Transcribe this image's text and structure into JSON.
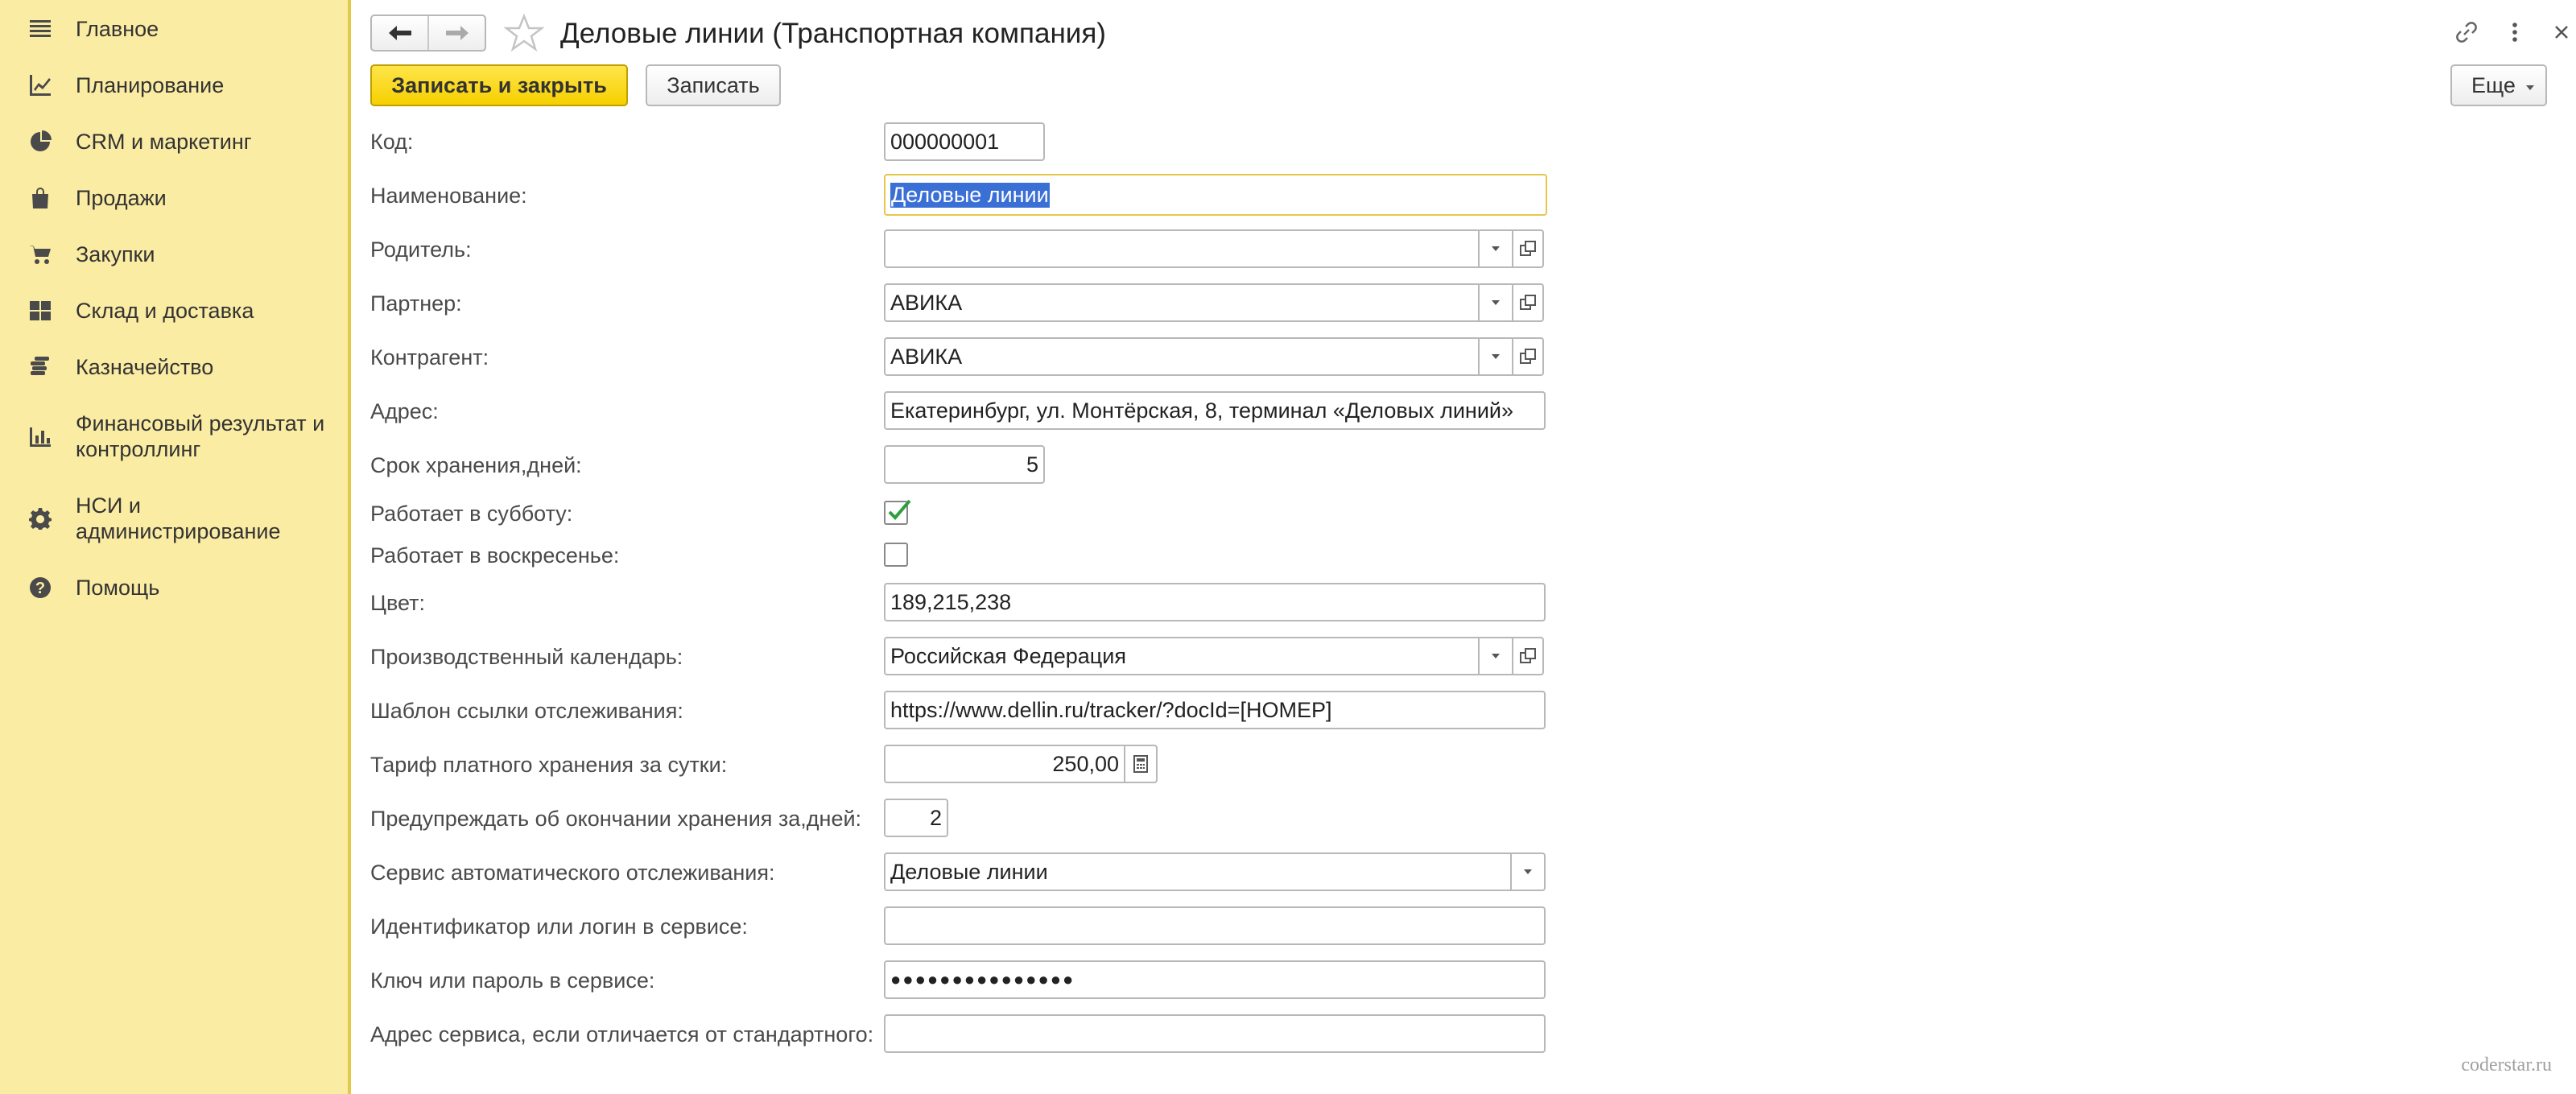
{
  "sidebar": {
    "items": [
      {
        "label": "Главное",
        "icon": "menu-lines-icon"
      },
      {
        "label": "Планирование",
        "icon": "planning-chart-icon"
      },
      {
        "label": "CRM и маркетинг",
        "icon": "pie-chart-icon"
      },
      {
        "label": "Продажи",
        "icon": "shopping-bag-icon"
      },
      {
        "label": "Закупки",
        "icon": "cart-icon"
      },
      {
        "label": "Склад и доставка",
        "icon": "grid-icon"
      },
      {
        "label": "Казначейство",
        "icon": "coins-icon"
      },
      {
        "label": "Финансовый результат и контроллинг",
        "icon": "bar-chart-icon"
      },
      {
        "label": "НСИ и администрирование",
        "icon": "gear-icon"
      },
      {
        "label": "Помощь",
        "icon": "help-icon"
      }
    ]
  },
  "header": {
    "title": "Деловые линии (Транспортная компания)"
  },
  "toolbar": {
    "save_close_label": "Записать и закрыть",
    "save_label": "Записать",
    "more_label": "Еще"
  },
  "form": {
    "code": {
      "label": "Код:",
      "value": "000000001"
    },
    "name": {
      "label": "Наименование:",
      "value": "Деловые линии"
    },
    "parent": {
      "label": "Родитель:",
      "value": ""
    },
    "partner": {
      "label": "Партнер:",
      "value": "АВИКА"
    },
    "counterparty": {
      "label": "Контрагент:",
      "value": "АВИКА"
    },
    "address": {
      "label": "Адрес:",
      "value": "Екатеринбург, ул. Монтёрская, 8, терминал «Деловых линий»"
    },
    "storage_days": {
      "label": "Срок хранения,дней:",
      "value": "5"
    },
    "works_saturday": {
      "label": "Работает в субботу:",
      "checked": true
    },
    "works_sunday": {
      "label": "Работает в воскресенье:",
      "checked": false
    },
    "color": {
      "label": "Цвет:",
      "value": "189,215,238"
    },
    "calendar": {
      "label": "Производственный календарь:",
      "value": "Российская Федерация"
    },
    "tracking_template": {
      "label": "Шаблон ссылки отслеживания:",
      "value": "https://www.dellin.ru/tracker/?docId=[НОМЕР]"
    },
    "storage_tariff": {
      "label": "Тариф платного хранения за сутки:",
      "value": "250,00"
    },
    "warn_days": {
      "label": "Предупреждать об окончании хранения за,дней:",
      "value": "2"
    },
    "tracking_service": {
      "label": "Сервис автоматического отслеживания:",
      "value": "Деловые линии"
    },
    "service_login": {
      "label": "Идентификатор или логин в сервисе:",
      "value": ""
    },
    "service_password": {
      "label": "Ключ или пароль в сервисе:",
      "value": "●●●●●●●●●●●●●●●"
    },
    "service_address": {
      "label": "Адрес сервиса, если отличается от стандартного:",
      "value": ""
    }
  },
  "watermark": "coderstar.ru"
}
